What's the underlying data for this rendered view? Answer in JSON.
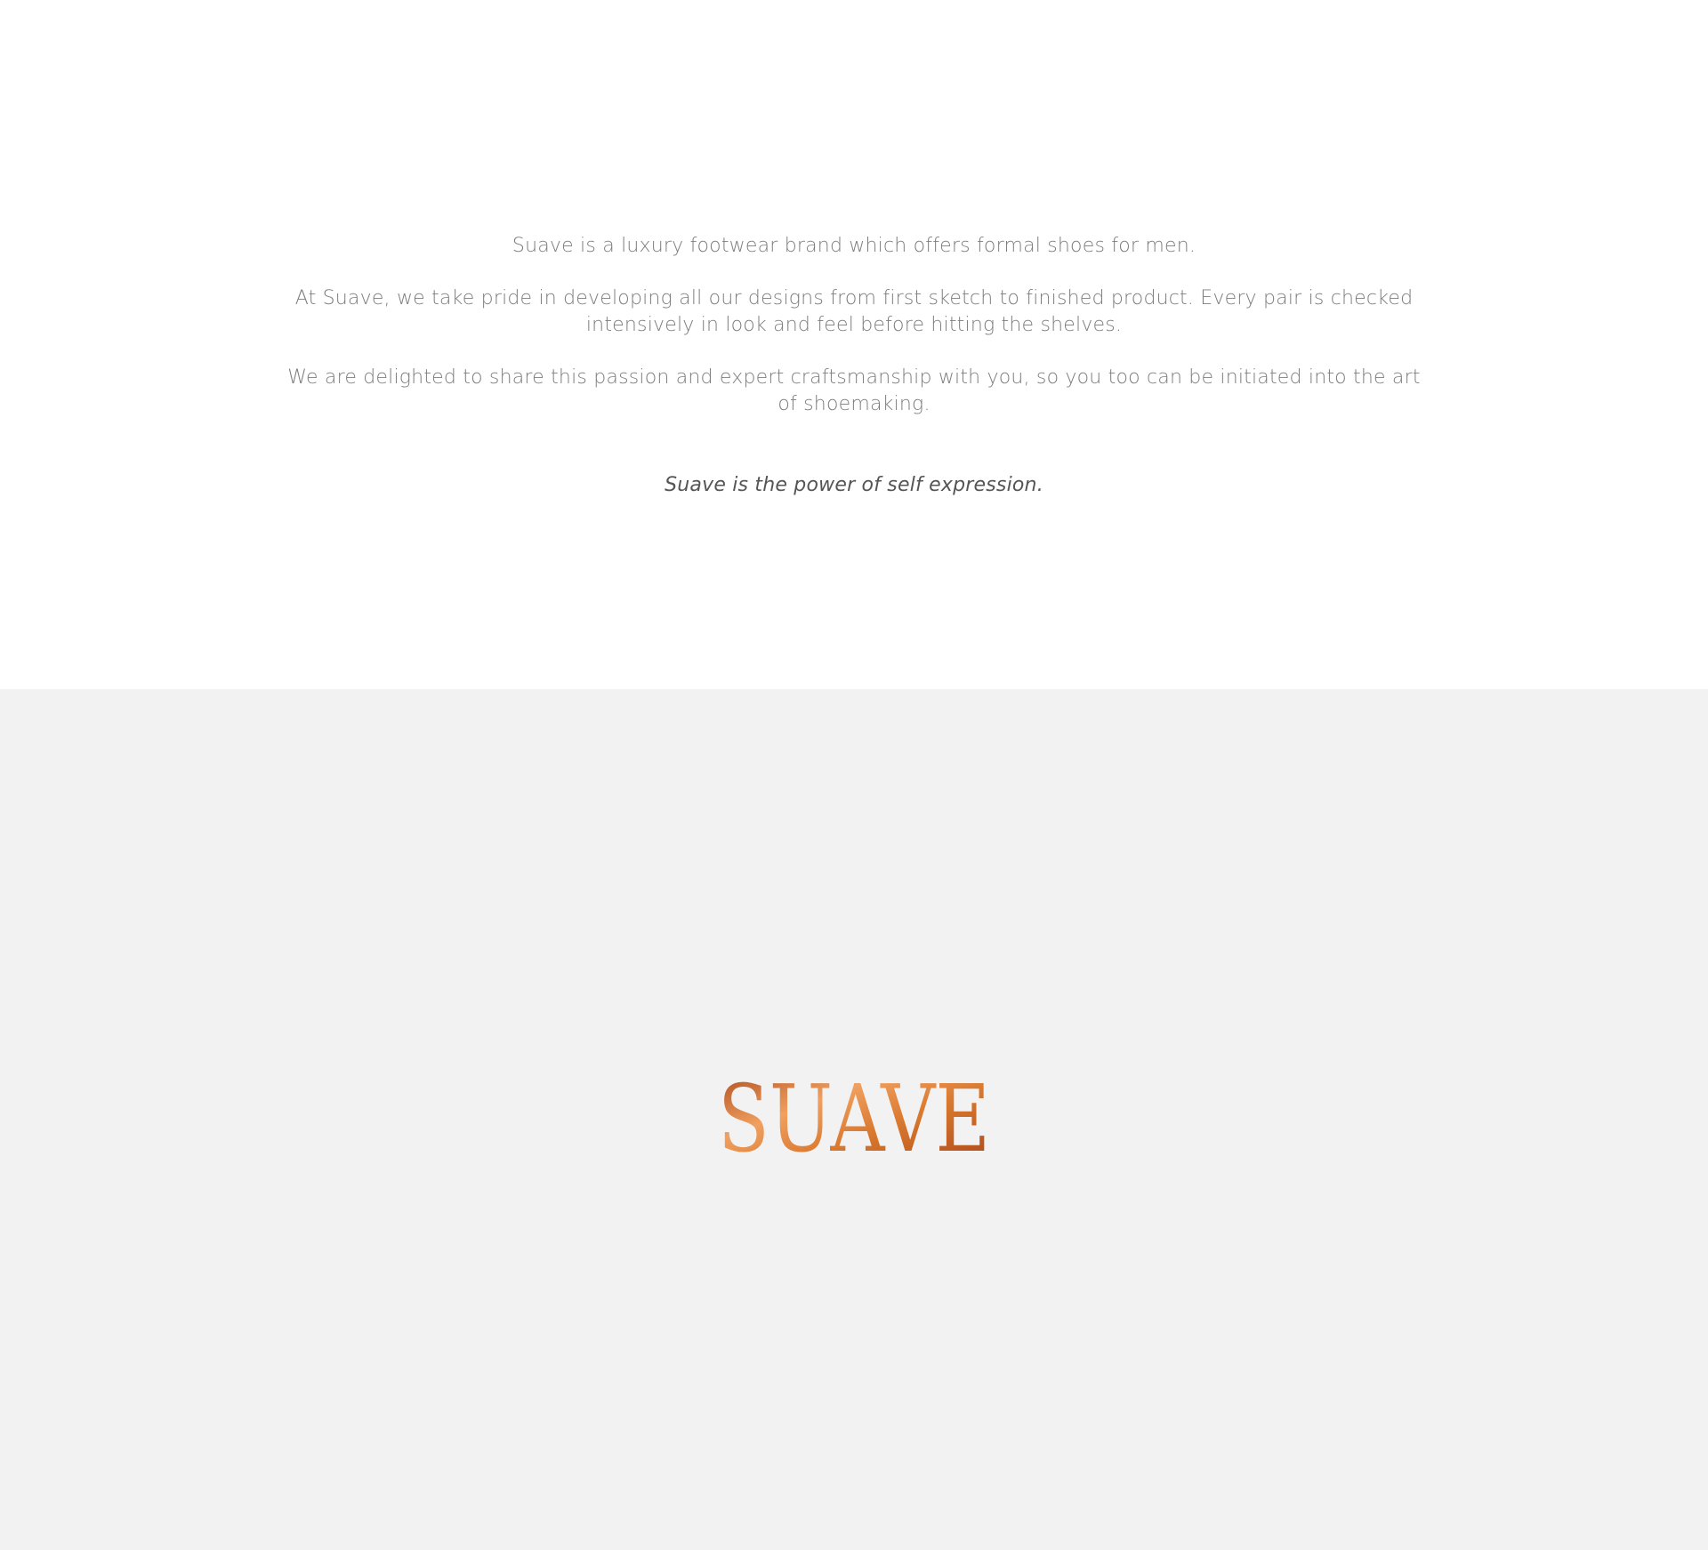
{
  "intro": {
    "paragraph_1": "Suave is a luxury footwear brand which offers formal shoes for men.",
    "paragraph_2": "At Suave, we take pride in developing all our designs from first sketch to finished product.  Every pair is checked intensively in look and feel before hitting the shelves.",
    "paragraph_3": "We are delighted to share this passion and expert craftsmanship with you, so you too can be initiated into the art of shoemaking.",
    "tagline": "Suave is the power of self expression."
  },
  "brand": {
    "logo_text": "SUAVE",
    "colors": {
      "logo_light": "#f0a060",
      "logo_mid": "#d9782e",
      "logo_dark": "#a84418",
      "background": "#f2f2f2",
      "body_text": "#7d7d7d",
      "tagline_text": "#555555"
    }
  }
}
